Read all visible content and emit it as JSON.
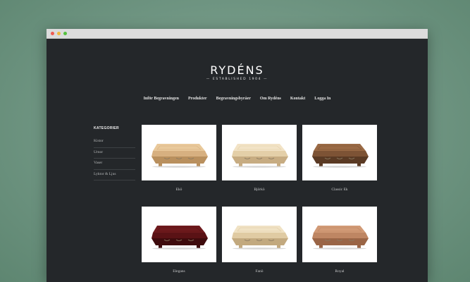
{
  "logo": {
    "name": "RYDÉNS",
    "tagline": "— ESTABLISHED 1904 —"
  },
  "nav": [
    "Inför Begravningen",
    "Produkter",
    "Begravningsbyråer",
    "Om Rydéns",
    "Kontakt",
    "Logga In"
  ],
  "sidebar": {
    "heading": "KATEGORIER",
    "items": [
      "Kistor",
      "Urnor",
      "Vaser",
      "Lyktor & Ljus"
    ]
  },
  "products": [
    {
      "name": "Ekö",
      "color_top": "#e9c99b",
      "color_side": "#d7b080",
      "color_dark": "#b9905e"
    },
    {
      "name": "Björkö",
      "color_top": "#f2e3c6",
      "color_side": "#e4cfa8",
      "color_dark": "#c7ac82"
    },
    {
      "name": "Classic Ek",
      "color_top": "#9a6a45",
      "color_side": "#7d5335",
      "color_dark": "#5a3a24"
    },
    {
      "name": "Elegans",
      "color_top": "#6e1a1d",
      "color_side": "#5a1215",
      "color_dark": "#3e0b0d"
    },
    {
      "name": "Fanö",
      "color_top": "#f0e2c4",
      "color_side": "#e0cba3",
      "color_dark": "#c2a97f"
    },
    {
      "name": "Royal",
      "color_top": "#d19a76",
      "color_side": "#be8663",
      "color_dark": "#9a6546"
    }
  ]
}
